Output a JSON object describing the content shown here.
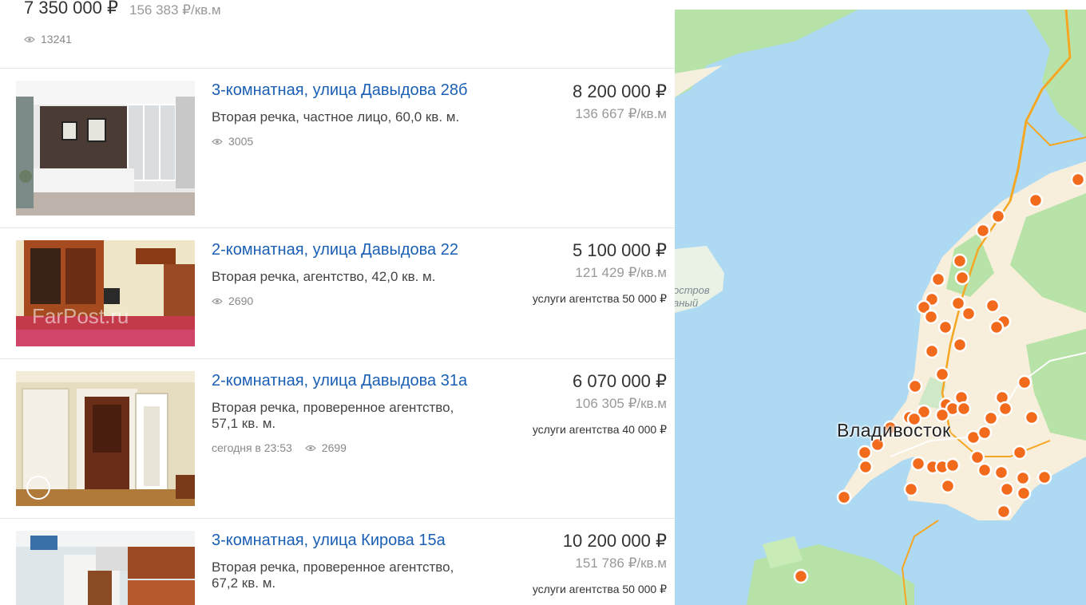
{
  "top_listing": {
    "price": "7 350 000 ₽",
    "price_per_m2": "156 383 ₽/кв.м",
    "views": "13241"
  },
  "listings": [
    {
      "title": "3-комнатная, улица Давыдова 28б",
      "desc": "Вторая речка, частное лицо, 60,0 кв. м.",
      "time": "",
      "views": "3005",
      "price": "8 200 000 ₽",
      "price_per_m2": "136 667 ₽/кв.м",
      "fee": ""
    },
    {
      "title": "2-комнатная, улица Давыдова 22",
      "desc": "Вторая речка, агентство, 42,0 кв. м.",
      "time": "",
      "views": "2690",
      "price": "5 100 000 ₽",
      "price_per_m2": "121 429 ₽/кв.м",
      "fee": "услуги агентства 50 000 ₽",
      "watermark": "FarPost.ru"
    },
    {
      "title": "2-комнатная, улица Давыдова 31а",
      "desc": "Вторая речка, проверенное агентство, 57,1 кв. м.",
      "time": "сегодня в 23:53",
      "views": "2699",
      "price": "6 070 000 ₽",
      "price_per_m2": "106 305 ₽/кв.м",
      "fee": "услуги агентства 40 000 ₽"
    },
    {
      "title": "3-комнатная, улица Кирова 15а",
      "desc": "Вторая речка, проверенное агентство, 67,2 кв. м.",
      "time": "",
      "views": "",
      "price": "10 200 000 ₽",
      "price_per_m2": "151 786 ₽/кв.м",
      "fee": "услуги агентства 50 000 ₽"
    }
  ],
  "map": {
    "city_label": "Владивосток",
    "island_label_line1": "остров",
    "island_label_line2": "аный",
    "marker_color": "#f26b1d",
    "water_color": "#aed9f2",
    "road_color": "#f5a623"
  }
}
